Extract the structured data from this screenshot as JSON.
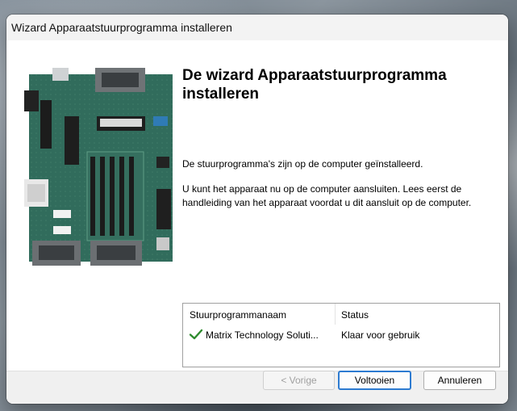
{
  "window": {
    "title": "Wizard Apparaatstuurprogramma installeren"
  },
  "wizard": {
    "heading": "De wizard Apparaatstuurprogramma installeren",
    "message1": "De stuurprogramma's zijn op de computer geïnstalleerd.",
    "message2": "U kunt het apparaat nu op de computer aansluiten. Lees eerst de handleiding van het apparaat voordat u dit aansluit op de computer."
  },
  "driver_list": {
    "columns": [
      "Stuurprogrammanaam",
      "Status"
    ],
    "rows": [
      {
        "name": "Matrix Technology Soluti...",
        "status": "Klaar voor gebruik",
        "icon": "checkmark-icon",
        "icon_color": "#2e8b2e"
      }
    ]
  },
  "buttons": {
    "back": "< Vorige",
    "finish": "Voltooien",
    "cancel": "Annuleren"
  },
  "banner": {
    "icon": "circuit-board-image"
  },
  "colors": {
    "accent": "#2d7bd1",
    "pcb_green": "#2f6b5a"
  }
}
